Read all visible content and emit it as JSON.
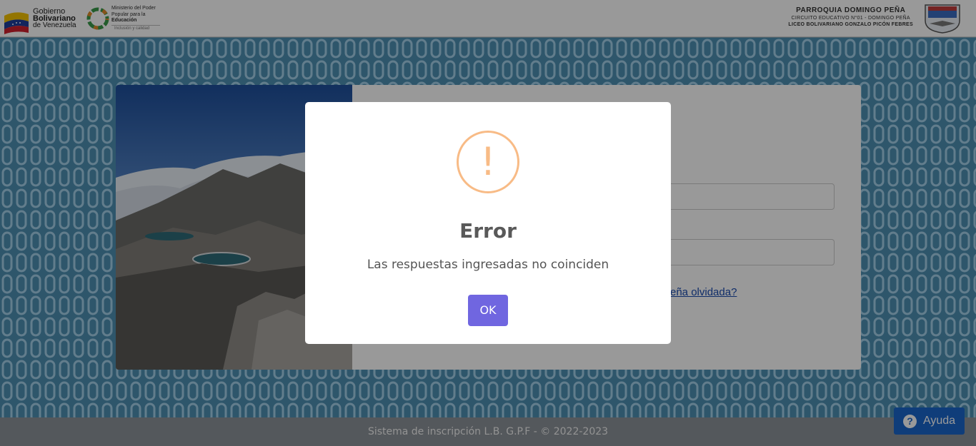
{
  "header": {
    "gov_line1": "Gobierno",
    "gov_line2": "Bolivariano",
    "gov_line3": "de Venezuela",
    "ministry_line1": "Ministerio del Poder",
    "ministry_line2": "Popular para la",
    "ministry_line3": "Educación",
    "ministry_tagline": "Inclusión y calidad",
    "parish": "PARROQUIA DOMINGO PEÑA",
    "circuit": "CIRCUITO EDUCATIVO N°01 - DOMINGO PEÑA",
    "school": "LICEO BOLIVARIANO GONZALO PICÓN FEBRES"
  },
  "login": {
    "forgot_link": "eña olvidada?"
  },
  "modal": {
    "icon": "warning-icon",
    "icon_glyph": "!",
    "title": "Error",
    "message": "Las respuestas ingresadas no coinciden",
    "ok_label": "OK",
    "accent_color": "#7066e0",
    "warning_color": "#f8bb86"
  },
  "help": {
    "label": "Ayuda",
    "icon": "question-icon",
    "icon_glyph": "?"
  },
  "footer": {
    "text": "Sistema de inscripción L.B. G.P.F - © 2022-2023"
  }
}
